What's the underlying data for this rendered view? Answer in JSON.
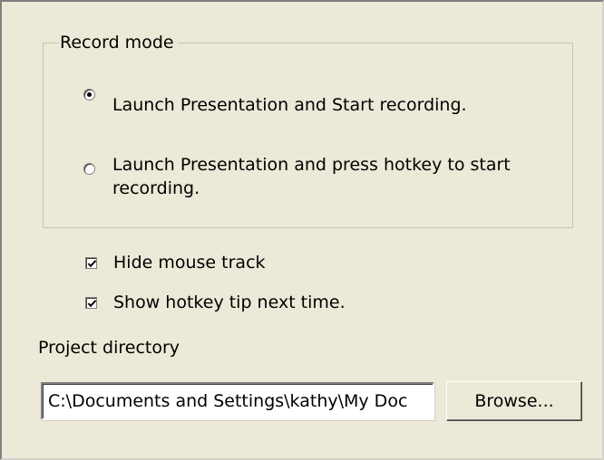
{
  "record_mode": {
    "legend": "Record mode",
    "options": [
      {
        "label": "Launch Presentation and Start recording.",
        "selected": true
      },
      {
        "label_line1": "Launch Presentation and press hotkey to start",
        "label_line2": "recording.",
        "selected": false
      }
    ]
  },
  "options": {
    "hide_mouse_track": {
      "label": "Hide mouse track",
      "checked": true
    },
    "show_hotkey_tip": {
      "label": "Show hotkey tip next time.",
      "checked": true
    }
  },
  "project_directory": {
    "label": "Project directory",
    "value": "C:\\Documents and Settings\\kathy\\My Doc",
    "browse_label": "Browse..."
  },
  "colors": {
    "dialog_background": "#ece9d8",
    "groupbox_border": "#c5c2b2"
  }
}
